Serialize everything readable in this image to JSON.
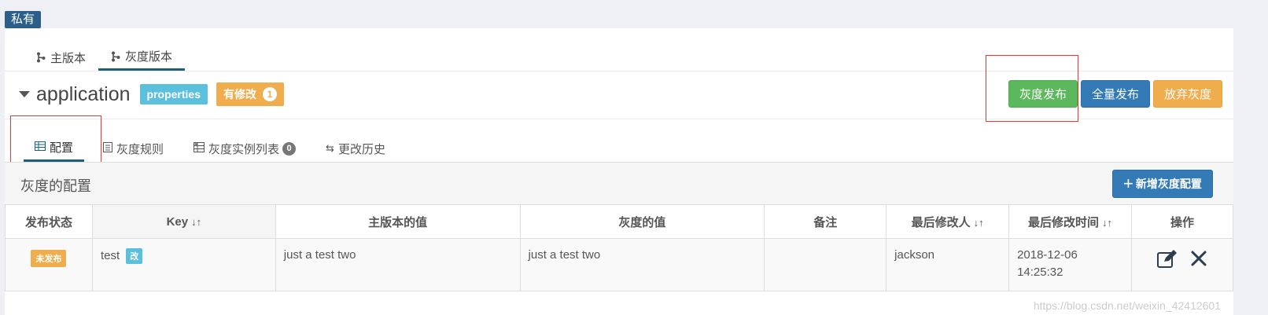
{
  "tag": {
    "label": "私有"
  },
  "version_tabs": [
    {
      "label": "主版本",
      "icon": "branch-icon"
    },
    {
      "label": "灰度版本",
      "icon": "branch-icon",
      "active": true
    }
  ],
  "namespace": {
    "name": "application",
    "format_label": "properties",
    "modified_label": "有修改",
    "modified_count": "1"
  },
  "actions": {
    "gray_publish": "灰度发布",
    "full_publish": "全量发布",
    "abandon_gray": "放弃灰度"
  },
  "sub_tabs": [
    {
      "label": "配置",
      "icon": "table-icon",
      "active": true
    },
    {
      "label": "灰度规则",
      "icon": "rule-icon"
    },
    {
      "label": "灰度实例列表",
      "icon": "instance-list-icon",
      "badge": "0"
    },
    {
      "label": "更改历史",
      "icon": "exchange-icon"
    }
  ],
  "section": {
    "title": "灰度的配置",
    "add_button": "新增灰度配置"
  },
  "table": {
    "headers": [
      "发布状态",
      "Key",
      "主版本的值",
      "灰度的值",
      "备注",
      "最后修改人",
      "最后修改时间",
      "操作"
    ],
    "rows": [
      {
        "status": "未发布",
        "key": "test",
        "key_tag": "改",
        "master_value": "just a test two",
        "gray_value": "just a test two",
        "comment": "",
        "modifier": "jackson",
        "modified_time": "2018-12-06 14:25:32"
      }
    ]
  },
  "watermark": "https://blog.csdn.net/weixin_42412601",
  "colors": {
    "primary": "#337ab7",
    "success": "#5cb85c",
    "warning": "#f0ad4e",
    "info": "#5bc0de",
    "tab_underline": "#1f5f7a",
    "highlight": "#e53935"
  }
}
